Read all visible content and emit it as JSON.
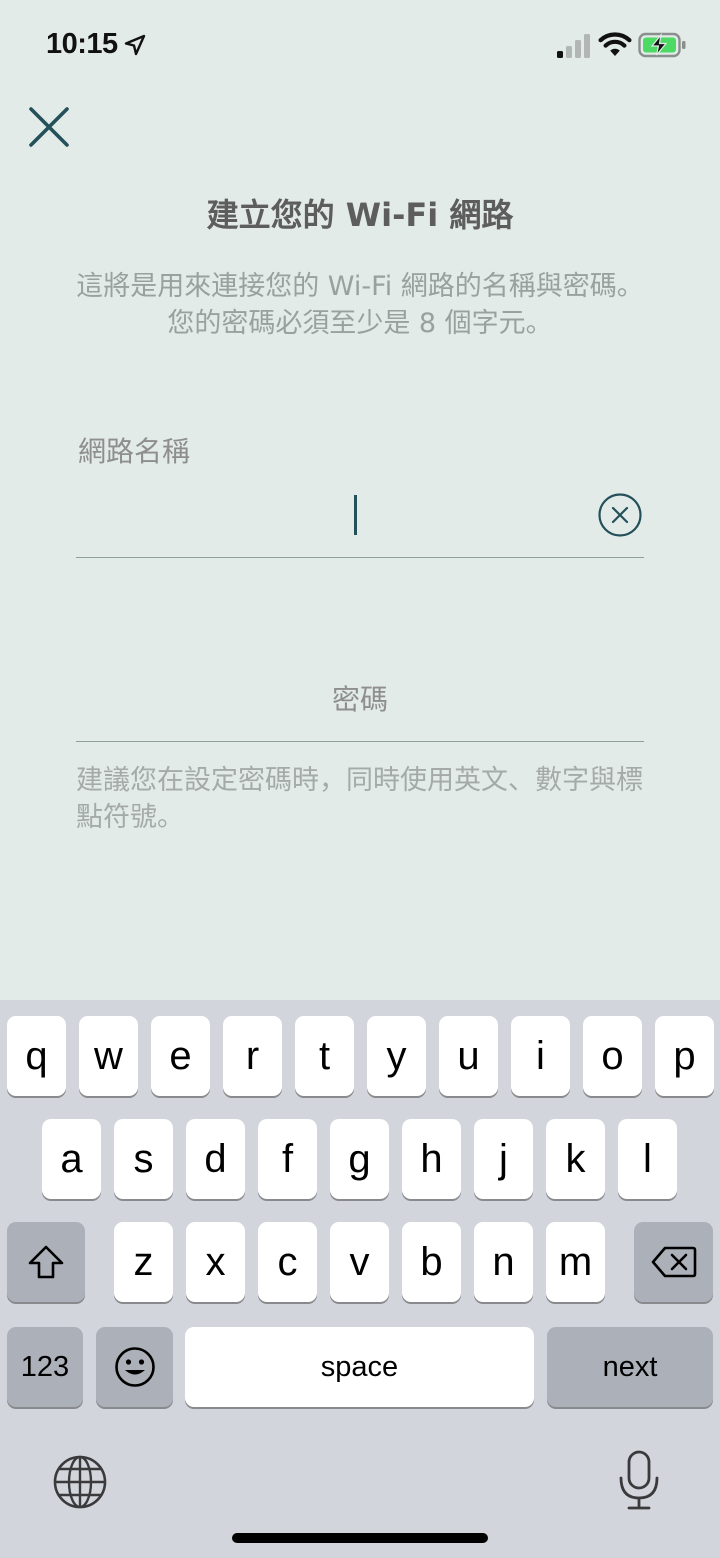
{
  "status_bar": {
    "time": "10:15",
    "icons": [
      "location-arrow-icon",
      "cellular-signal-icon",
      "wifi-icon",
      "battery-charging-icon"
    ],
    "battery_color": "#4cd964"
  },
  "header": {
    "close_icon": "close-icon",
    "title": "建立您的 Wi-Fi 網路",
    "description": "這將是用來連接您的 Wi-Fi 網路的名稱與密碼。您的密碼必須至少是 8 個字元。"
  },
  "form": {
    "network_name": {
      "label": "網路名稱",
      "value": "",
      "clear_icon": "clear-circle-icon"
    },
    "password": {
      "placeholder": "密碼",
      "value": "",
      "hint": "建議您在設定密碼時，同時使用英文、數字與標點符號。"
    }
  },
  "colors": {
    "accent": "#24505a",
    "background": "#e2ebe8"
  },
  "keyboard": {
    "row1": [
      "q",
      "w",
      "e",
      "r",
      "t",
      "y",
      "u",
      "i",
      "o",
      "p"
    ],
    "row2": [
      "a",
      "s",
      "d",
      "f",
      "g",
      "h",
      "j",
      "k",
      "l"
    ],
    "row3": [
      "z",
      "x",
      "c",
      "v",
      "b",
      "n",
      "m"
    ],
    "numbers_label": "123",
    "space_label": "space",
    "next_label": "next",
    "function_icons": [
      "shift-icon",
      "backspace-icon",
      "emoji-icon",
      "globe-icon",
      "microphone-icon"
    ]
  }
}
